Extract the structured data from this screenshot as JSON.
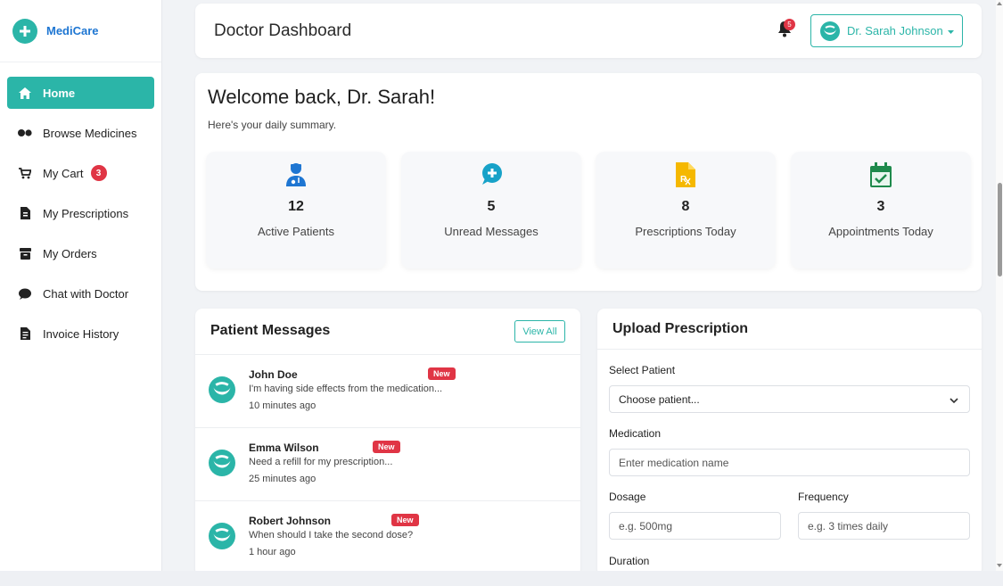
{
  "brand": {
    "name": "MediCare"
  },
  "sidebar": {
    "items": [
      {
        "label": "Home",
        "icon": "home-icon"
      },
      {
        "label": "Browse Medicines",
        "icon": "pills-icon"
      },
      {
        "label": "My Cart",
        "icon": "cart-icon",
        "badge": "3"
      },
      {
        "label": "My Prescriptions",
        "icon": "prescription-file-icon"
      },
      {
        "label": "My Orders",
        "icon": "box-icon"
      },
      {
        "label": "Chat with Doctor",
        "icon": "chat-icon"
      },
      {
        "label": "Invoice History",
        "icon": "invoice-icon"
      }
    ]
  },
  "header": {
    "title": "Doctor Dashboard",
    "notification_count": "5",
    "user_name": "Dr. Sarah Johnson"
  },
  "welcome": {
    "title": "Welcome back, Dr. Sarah!",
    "subtitle": "Here's your daily summary.",
    "stats": [
      {
        "value": "12",
        "label": "Active Patients",
        "icon": "patient-icon",
        "color": "#1e76d2"
      },
      {
        "value": "5",
        "label": "Unread Messages",
        "icon": "message-plus-icon",
        "color": "#17a2c8"
      },
      {
        "value": "8",
        "label": "Prescriptions Today",
        "icon": "rx-file-icon",
        "color": "#f5b800"
      },
      {
        "value": "3",
        "label": "Appointments Today",
        "icon": "calendar-check-icon",
        "color": "#1f8a4c"
      }
    ]
  },
  "messages": {
    "title": "Patient Messages",
    "view_all_label": "View All",
    "new_label": "New",
    "items": [
      {
        "name": "John Doe",
        "text": "I'm having side effects from the medication...",
        "time": "10 minutes ago"
      },
      {
        "name": "Emma Wilson",
        "text": "Need a refill for my prescription...",
        "time": "25 minutes ago"
      },
      {
        "name": "Robert Johnson",
        "text": "When should I take the second dose?",
        "time": "1 hour ago"
      }
    ]
  },
  "upload": {
    "title": "Upload Prescription",
    "patient_label": "Select Patient",
    "patient_value": "Choose patient...",
    "medication_label": "Medication",
    "medication_placeholder": "Enter medication name",
    "dosage_label": "Dosage",
    "dosage_placeholder": "e.g. 500mg",
    "frequency_label": "Frequency",
    "frequency_placeholder": "e.g. 3 times daily",
    "duration_label": "Duration"
  },
  "colors": {
    "accent": "#2bb5a8",
    "brand": "#1e76d2",
    "danger": "#e03545"
  }
}
